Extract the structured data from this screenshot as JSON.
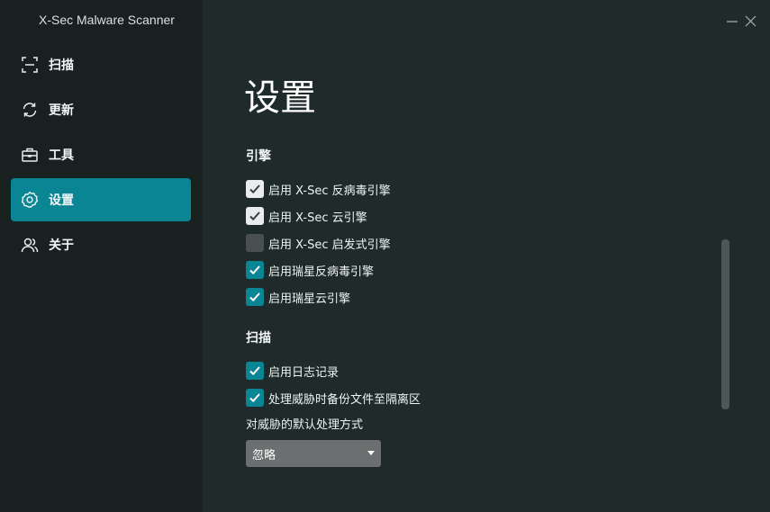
{
  "app": {
    "title": "X-Sec Malware Scanner"
  },
  "window_controls": [
    {
      "icon": "minimize-icon"
    },
    {
      "icon": "close-icon"
    }
  ],
  "sidebar": {
    "items": [
      {
        "label": "扫描",
        "icon": "scan-icon",
        "active": false
      },
      {
        "label": "更新",
        "icon": "refresh-icon",
        "active": false
      },
      {
        "label": "工具",
        "icon": "toolbox-icon",
        "active": false
      },
      {
        "label": "设置",
        "icon": "gear-icon",
        "active": true
      },
      {
        "label": "关于",
        "icon": "users-icon",
        "active": false
      }
    ]
  },
  "main": {
    "title": "设置",
    "engine_section": {
      "title": "引擎",
      "options": [
        {
          "label": "启用 X-Sec 反病毒引擎",
          "checked": true,
          "style": "grey"
        },
        {
          "label": "启用 X-Sec 云引擎",
          "checked": true,
          "style": "grey"
        },
        {
          "label": "启用 X-Sec 启发式引擎",
          "checked": false,
          "style": "grey"
        },
        {
          "label": "启用瑞星反病毒引擎",
          "checked": true,
          "style": "teal"
        },
        {
          "label": "启用瑞星云引擎",
          "checked": true,
          "style": "teal"
        }
      ]
    },
    "scan_section": {
      "title": "扫描",
      "options": [
        {
          "label": "启用日志记录",
          "checked": true,
          "style": "teal"
        },
        {
          "label": "处理威胁时备份文件至隔离区",
          "checked": true,
          "style": "teal"
        }
      ],
      "default_action_label": "对威胁的默认处理方式",
      "default_action_value": "忽略"
    }
  },
  "colors": {
    "accent": "#0a8593",
    "sidebar_bg": "#182120",
    "main_bg": "#1f2b2a"
  }
}
